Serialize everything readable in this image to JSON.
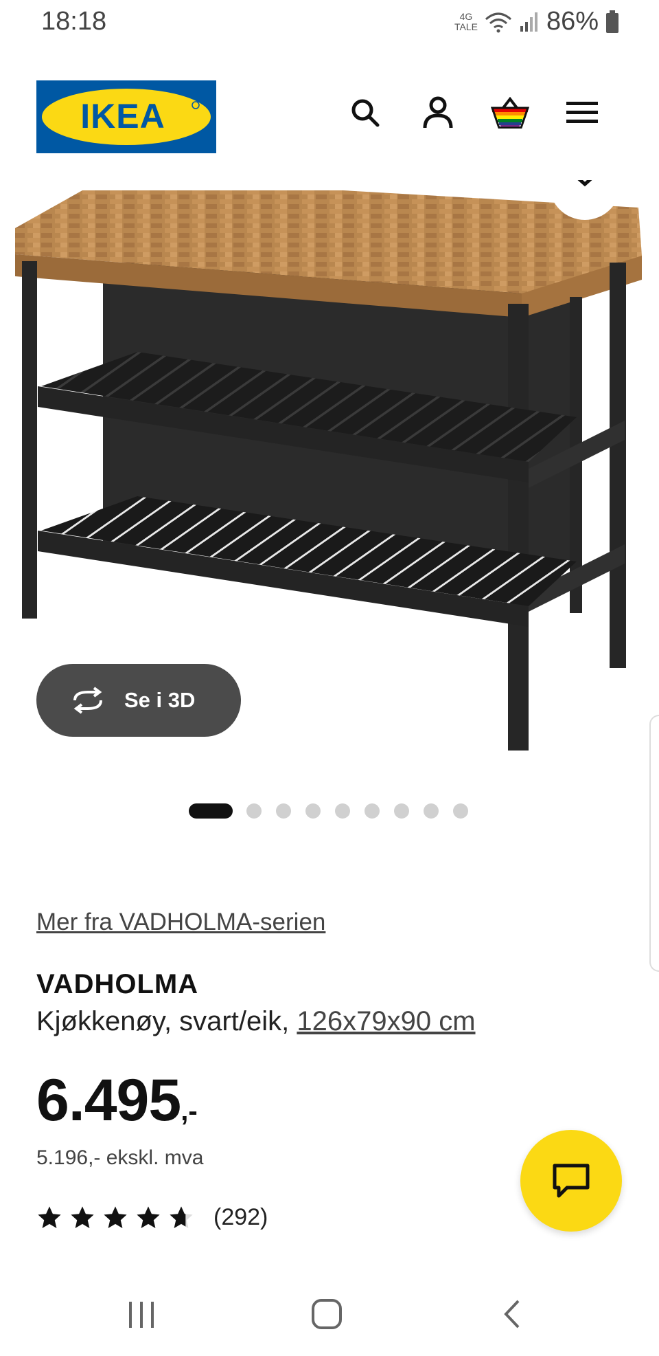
{
  "status_bar": {
    "time": "18:18",
    "network_top": "4G",
    "network_bottom": "TALE",
    "battery": "86%"
  },
  "header": {
    "logo_text": "IKEA",
    "icons": [
      "search-icon",
      "account-icon",
      "shopping-bag-icon",
      "menu-icon"
    ]
  },
  "gallery": {
    "view_3d_label": "Se i 3D",
    "total_images": 9,
    "active_index": 0
  },
  "product": {
    "series_link": "Mer fra VADHOLMA-serien",
    "name": "VADHOLMA",
    "description": "Kjøkkenøy, svart/eik,",
    "dimensions": "126x79x90 cm",
    "price_main": "6.495",
    "price_suffix": ",-",
    "price_ex_vat": "5.196,- ekskl. mva",
    "rating": 4.7,
    "review_count": "(292)"
  },
  "colors": {
    "brand_blue": "#0058a3",
    "brand_yellow": "#fbd914",
    "dark_button": "#4b4b4b"
  }
}
